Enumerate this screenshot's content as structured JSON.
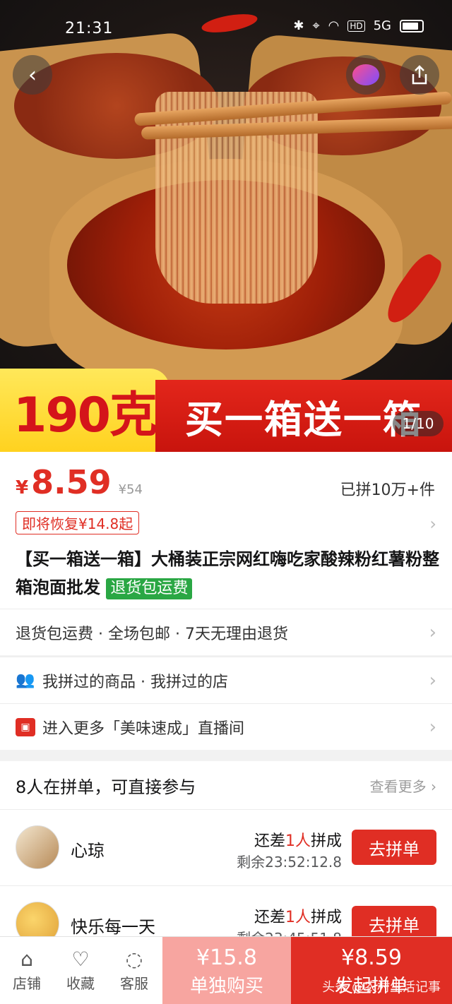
{
  "status_bar": {
    "time": "21:31",
    "network": "5G",
    "hd": "HD"
  },
  "hero": {
    "weight_label": "190克",
    "promo_label": "买一箱送一箱",
    "image_index": "1/10"
  },
  "price": {
    "symbol": "¥",
    "current": "8.59",
    "original": "¥54",
    "sold": "已拼10万+件",
    "coupon": "即将恢复¥14.8起"
  },
  "product": {
    "title": "【买一箱送一箱】大桶装正宗网红嗨吃家酸辣粉红薯粉整箱泡面批发",
    "tag": "退货包运费"
  },
  "services": {
    "text": "退货包运费 · 全场包邮 · 7天无理由退货"
  },
  "history": {
    "text": "我拼过的商品 · 我拼过的店"
  },
  "live": {
    "text": "进入更多「美味速成」直播间"
  },
  "group": {
    "header": "8人在拼单，可直接参与",
    "more": "查看更多",
    "items": [
      {
        "name": "心琼",
        "need_prefix": "还差",
        "need_count": "1人",
        "need_suffix": "拼成",
        "remaining": "剩余23:52:12.8",
        "button": "去拼单"
      },
      {
        "name": "快乐每一天",
        "need_prefix": "还差",
        "need_count": "1人",
        "need_suffix": "拼成",
        "remaining": "剩余23:45:51.8",
        "button": "去拼单"
      }
    ]
  },
  "bottom_bar": {
    "store": "店铺",
    "favorite": "收藏",
    "service": "客服",
    "single_price": "¥15.8",
    "single_label": "单独购买",
    "group_price": "¥8.59",
    "group_label": "发起拼单"
  },
  "watermark": "头条 @农村生活记事",
  "colors": {
    "accent": "#e02e24",
    "green_tag": "#2aa744",
    "promo_yellow": "#ffd21f"
  }
}
